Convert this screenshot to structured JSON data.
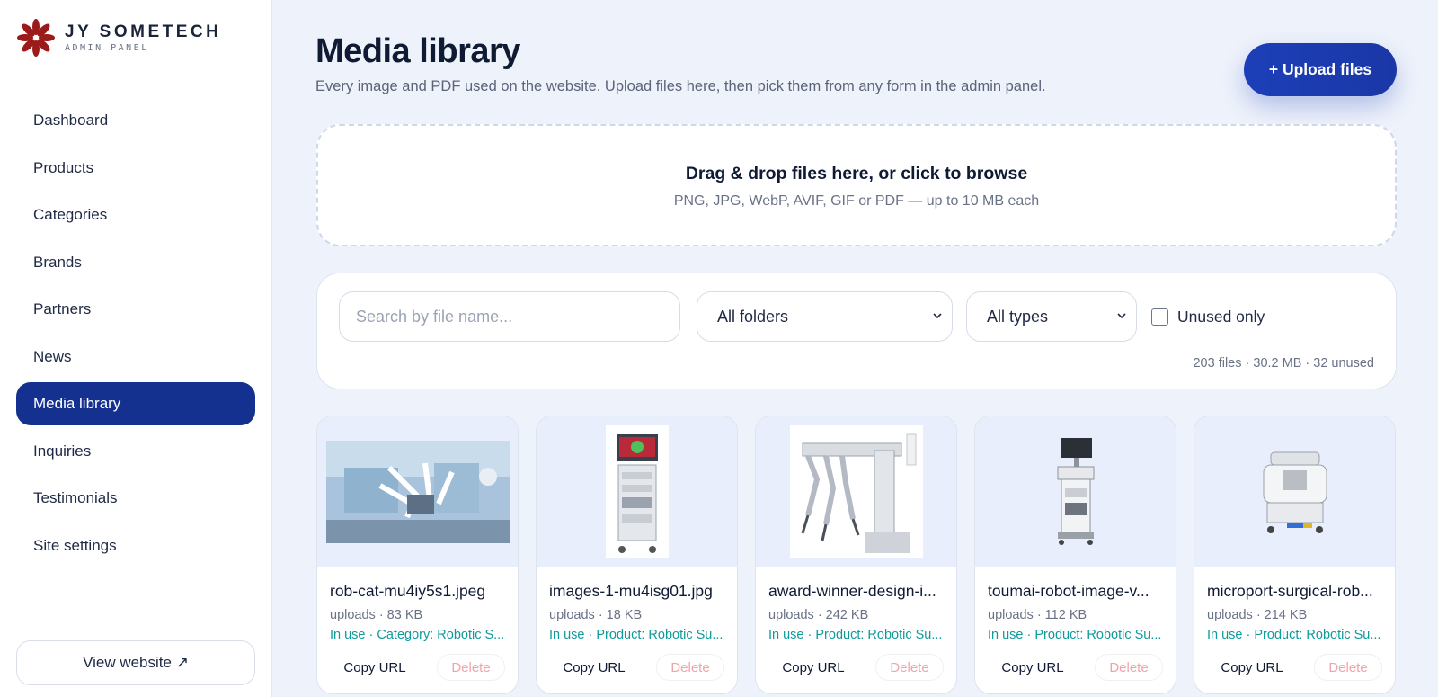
{
  "brand": {
    "name": "JY SOMETECH",
    "sub": "ADMIN PANEL",
    "logo_icon": "red-flower-logo-icon",
    "logo_color": "#9b1b1b"
  },
  "sidebar": {
    "items": [
      {
        "label": "Dashboard",
        "active": false
      },
      {
        "label": "Products",
        "active": false
      },
      {
        "label": "Categories",
        "active": false
      },
      {
        "label": "Brands",
        "active": false
      },
      {
        "label": "Partners",
        "active": false
      },
      {
        "label": "News",
        "active": false
      },
      {
        "label": "Media library",
        "active": true
      },
      {
        "label": "Inquiries",
        "active": false
      },
      {
        "label": "Testimonials",
        "active": false
      },
      {
        "label": "Site settings",
        "active": false
      }
    ],
    "view_website": "View website ↗",
    "active_color": "#14318f"
  },
  "header": {
    "title": "Media library",
    "description": "Every image and PDF used on the website. Upload files here, then pick them from any form in the admin panel.",
    "upload_label": "+ Upload files"
  },
  "dropzone": {
    "title": "Drag & drop files here, or click to browse",
    "subtitle": "PNG, JPG, WebP, AVIF, GIF or PDF — up to 10 MB each"
  },
  "filters": {
    "search_placeholder": "Search by file name...",
    "folder_value": "All folders",
    "type_value": "All types",
    "unused_label": "Unused only",
    "unused_checked": false,
    "stats": "203 files · 30.2 MB · 32 unused"
  },
  "cards": [
    {
      "name": "rob-cat-mu4iy5s1.jpeg",
      "meta": "uploads · 83 KB",
      "usage": "In use · Category: Robotic S...",
      "copy": "Copy URL",
      "delete": "Delete",
      "thumb": "surgical-robot-room-photo"
    },
    {
      "name": "images-1-mu4isg01.jpg",
      "meta": "uploads · 18 KB",
      "usage": "In use · Product: Robotic Su...",
      "copy": "Copy URL",
      "delete": "Delete",
      "thumb": "endoscopy-tower-photo"
    },
    {
      "name": "award-winner-design-i...",
      "meta": "uploads · 242 KB",
      "usage": "In use · Product: Robotic Su...",
      "copy": "Copy URL",
      "delete": "Delete",
      "thumb": "robot-arm-photo"
    },
    {
      "name": "toumai-robot-image-v...",
      "meta": "uploads · 112 KB",
      "usage": "In use · Product: Robotic Su...",
      "copy": "Copy URL",
      "delete": "Delete",
      "thumb": "surgeon-console-photo"
    },
    {
      "name": "microport-surgical-rob...",
      "meta": "uploads · 214 KB",
      "usage": "In use · Product: Robotic Su...",
      "copy": "Copy URL",
      "delete": "Delete",
      "thumb": "surgical-robot-cart-photo"
    }
  ],
  "colors": {
    "usage": "#0f9a9a",
    "delete": "#f0a4aa",
    "accent": "#1c3fb8"
  }
}
